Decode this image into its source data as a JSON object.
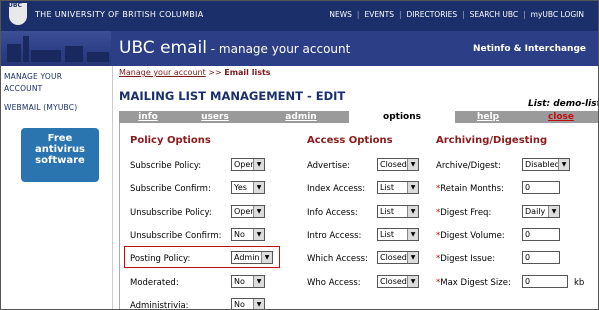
{
  "topbar": {
    "logo_text": "UBC",
    "university": "THE UNIVERSITY OF BRITISH COLUMBIA",
    "links": [
      "NEWS",
      "EVENTS",
      "DIRECTORIES",
      "SEARCH UBC",
      "myUBC LOGIN"
    ]
  },
  "banner": {
    "title": "UBC email",
    "subtitle": " - manage your account",
    "netinfo": "Netinfo & Interchange"
  },
  "sidebar": {
    "links": [
      "MANAGE YOUR",
      "ACCOUNT",
      "WEBMAIL (MYUBC)"
    ],
    "promo": [
      "Free",
      "antivirus",
      "software"
    ]
  },
  "breadcrumb": {
    "link": "Manage your account",
    "sep": ">>",
    "current": "Email lists"
  },
  "page_title": "MAILING LIST MANAGEMENT - EDIT",
  "list_name": "List: demo-list",
  "tabs": [
    "info",
    "users",
    "admin",
    "options",
    "help",
    "close"
  ],
  "columns": {
    "policy": {
      "header": "Policy Options",
      "rows": [
        {
          "label": "Subscribe Policy:",
          "value": "Open"
        },
        {
          "label": "Subscribe Confirm:",
          "value": "Yes"
        },
        {
          "label": "Unsubscribe Policy:",
          "value": "Open"
        },
        {
          "label": "Unsubscribe Confirm:",
          "value": "No"
        },
        {
          "label": "Posting Policy:",
          "value": "Admin"
        },
        {
          "label": "Moderated:",
          "value": "No"
        },
        {
          "label": "Administrivia:",
          "value": "No"
        }
      ]
    },
    "access": {
      "header": "Access Options",
      "rows": [
        {
          "label": "Advertise:",
          "value": "Closed"
        },
        {
          "label": "Index Access:",
          "value": "List"
        },
        {
          "label": "Info Access:",
          "value": "List"
        },
        {
          "label": "Intro Access:",
          "value": "List"
        },
        {
          "label": "Which Access:",
          "value": "Closed"
        },
        {
          "label": "Who Access:",
          "value": "Closed"
        }
      ]
    },
    "archiving": {
      "header": "Archiving/Digesting",
      "rows": [
        {
          "star": "",
          "label": "Archive/Digest:",
          "value": "Disabled",
          "kind": "select"
        },
        {
          "star": "*",
          "label": "Retain Months:",
          "value": "0",
          "kind": "input"
        },
        {
          "star": "*",
          "label": "Digest Freq:",
          "value": "Daily",
          "kind": "select"
        },
        {
          "star": "*",
          "label": "Digest Volume:",
          "value": "0",
          "kind": "input"
        },
        {
          "star": "*",
          "label": "Digest Issue:",
          "value": "0",
          "kind": "input"
        },
        {
          "star": "*",
          "label": "Max Digest Size:",
          "value": "0",
          "kind": "input",
          "unit": "kb"
        }
      ]
    }
  },
  "colors": {
    "navy": "#1b2f6b",
    "banner": "#2c3e85",
    "header_red": "#8b1a1a",
    "highlight": "#c01010"
  }
}
